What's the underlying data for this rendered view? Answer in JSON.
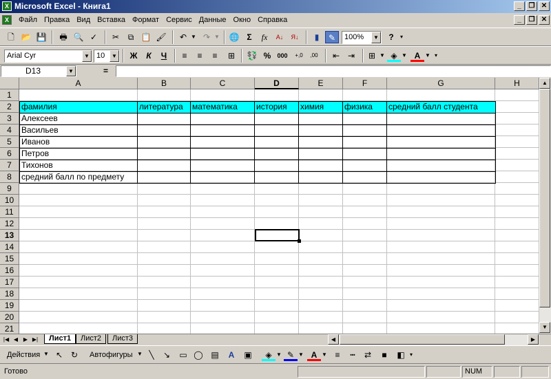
{
  "window": {
    "title": "Microsoft Excel - Книга1",
    "app_icon": "excel-icon"
  },
  "menu": [
    "Файл",
    "Правка",
    "Вид",
    "Вставка",
    "Формат",
    "Сервис",
    "Данные",
    "Окно",
    "Справка"
  ],
  "toolbar": {
    "zoom": "100%"
  },
  "format": {
    "font": "Arial Cyr",
    "size": "10",
    "bold": "Ж",
    "italic": "К",
    "underline": "Ч",
    "percent": "%",
    "thousands": "000"
  },
  "formula_bar": {
    "name_box": "D13",
    "eq": "=",
    "value": ""
  },
  "grid": {
    "columns": [
      "A",
      "B",
      "C",
      "D",
      "E",
      "F",
      "G",
      "H"
    ],
    "active_column": "D",
    "rows": [
      "1",
      "2",
      "3",
      "4",
      "5",
      "6",
      "7",
      "8",
      "9",
      "10",
      "11",
      "12",
      "13",
      "14",
      "15",
      "16",
      "17",
      "18",
      "19",
      "20",
      "21"
    ],
    "active_row": "13",
    "header_row": [
      "фамилия",
      "литература",
      "математика",
      "история",
      "химия",
      "физика",
      "средний балл студента"
    ],
    "names": [
      "Алексеев",
      "Васильев",
      "Иванов",
      "Петров",
      "Тихонов",
      "средний балл по предмету"
    ]
  },
  "sheets": [
    "Лист1",
    "Лист2",
    "Лист3"
  ],
  "drawing": {
    "actions": "Действия",
    "autoshapes": "Автофигуры"
  },
  "status": {
    "ready": "Готово",
    "num": "NUM"
  },
  "colors": {
    "header_fill": "#00ffff",
    "title_gradient_start": "#0a246a"
  }
}
